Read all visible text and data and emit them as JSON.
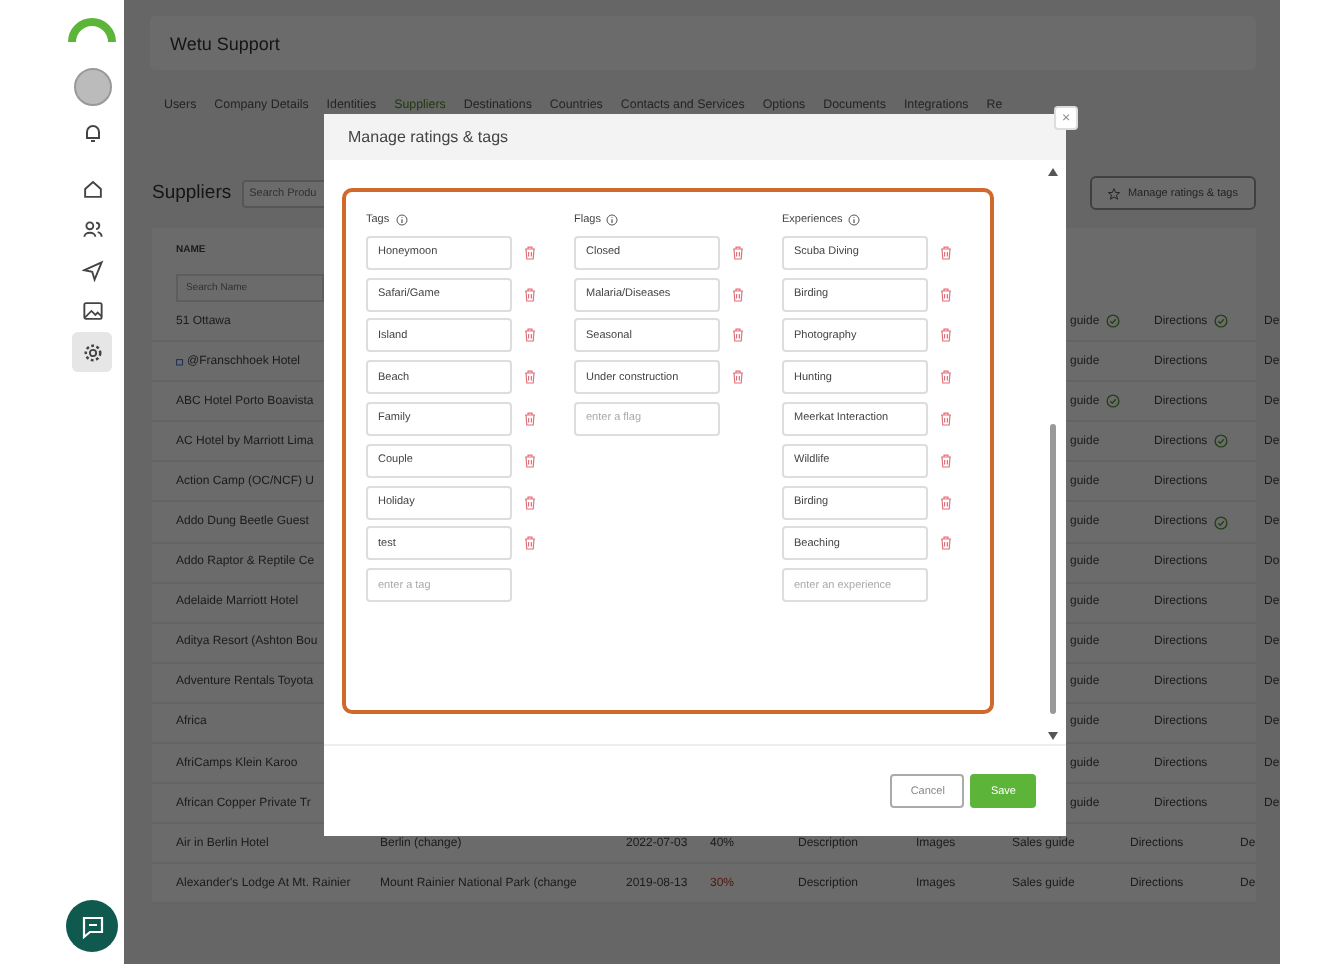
{
  "app": {
    "title": "Wetu Support"
  },
  "sidebar": {
    "items": [
      {
        "kind": "home",
        "selected": false
      },
      {
        "kind": "users",
        "selected": false
      },
      {
        "kind": "send",
        "selected": false
      },
      {
        "kind": "image",
        "selected": false
      },
      {
        "kind": "settings",
        "selected": true
      }
    ]
  },
  "tabs": [
    {
      "label": "Users",
      "selected": false
    },
    {
      "label": "Company Details",
      "selected": false
    },
    {
      "label": "Identities",
      "selected": false
    },
    {
      "label": "Suppliers",
      "selected": true
    },
    {
      "label": "Destinations",
      "selected": false
    },
    {
      "label": "Countries",
      "selected": false
    },
    {
      "label": "Contacts and Services",
      "selected": false
    },
    {
      "label": "Options",
      "selected": false
    },
    {
      "label": "Documents",
      "selected": false
    },
    {
      "label": "Integrations",
      "selected": false
    },
    {
      "label": "Re",
      "selected": false
    }
  ],
  "suppliers": {
    "heading": "Suppliers",
    "search": {
      "placeholder": "Search Produ"
    },
    "manage_button": "Manage ratings & tags",
    "table": {
      "columns": [
        "NAME"
      ],
      "name_search": {
        "placeholder": "Search Name"
      },
      "rows": [
        {
          "kind": "behind",
          "name": "51 Ottawa",
          "sales": "guide",
          "sales_check": true,
          "directions": "Directions",
          "directions_check": true,
          "last": "De"
        },
        {
          "kind": "behind",
          "name": "@Franschhoek Hotel",
          "name_icon": true,
          "sales": "guide",
          "sales_check": false,
          "directions": "Directions",
          "directions_check": false,
          "last": "De"
        },
        {
          "kind": "behind",
          "name": "ABC Hotel Porto Boavista",
          "sales": "guide",
          "sales_check": true,
          "directions": "Directions",
          "directions_check": false,
          "last": "De"
        },
        {
          "kind": "behind",
          "name": "AC Hotel by Marriott Lima",
          "sales": "guide",
          "sales_check": false,
          "directions": "Directions",
          "directions_check": true,
          "last": "De"
        },
        {
          "kind": "behind",
          "name": "Action Camp (OC/NCF) U",
          "sales": "guide",
          "sales_check": false,
          "directions": "Directions",
          "directions_check": false,
          "last": "De"
        },
        {
          "kind": "behind",
          "name": "Addo Dung Beetle Guest",
          "sales": "guide",
          "sales_check": false,
          "directions": "Directions",
          "directions_check": true,
          "last": "De"
        },
        {
          "kind": "behind",
          "name": "Addo Raptor & Reptile Ce",
          "sales": "guide",
          "sales_check": false,
          "directions": "Directions",
          "directions_check": false,
          "last": "Do"
        },
        {
          "kind": "behind",
          "name": "Adelaide Marriott Hotel",
          "sales": "guide",
          "sales_check": false,
          "directions": "Directions",
          "directions_check": false,
          "last": "De"
        },
        {
          "kind": "behind",
          "name": "Aditya Resort (Ashton Bou",
          "sales": "guide",
          "sales_check": false,
          "directions": "Directions",
          "directions_check": false,
          "last": "De"
        },
        {
          "kind": "behind",
          "name": "Adventure Rentals Toyota",
          "sales": "guide",
          "sales_check": false,
          "directions": "Directions",
          "directions_check": false,
          "last": "De"
        },
        {
          "kind": "behind",
          "name": "Africa",
          "sales": "guide",
          "sales_check": false,
          "directions": "Directions",
          "directions_check": false,
          "last": "De"
        },
        {
          "kind": "behind",
          "name": "AfriCamps Klein Karoo",
          "sales": "guide",
          "sales_check": false,
          "directions": "Directions",
          "directions_check": false,
          "last": "De"
        },
        {
          "kind": "behind",
          "name": "African Copper Private Tr",
          "sales": "guide",
          "sales_check": false,
          "directions": "Directions",
          "directions_check": false,
          "last": "De"
        },
        {
          "kind": "full",
          "name": "Air in Berlin Hotel",
          "location": "Berlin (change)",
          "date": "2022-07-03",
          "score": "40%",
          "score_warning": false,
          "description": "Description",
          "images": "Images",
          "sales": "Sales guide",
          "directions": "Directions",
          "last": "De"
        },
        {
          "kind": "full",
          "name": "Alexander's Lodge At Mt. Rainier",
          "location": "Mount Rainier National Park (change",
          "date": "2019-08-13",
          "score": "30%",
          "score_warning": true,
          "description": "Description",
          "images": "Images",
          "sales": "Sales guide",
          "directions": "Directions",
          "last": "De"
        }
      ]
    }
  },
  "modal": {
    "title": "Manage ratings & tags",
    "close": "×",
    "groups": [
      {
        "label": "Tags",
        "items": [
          "Honeymoon",
          "Safari/Game",
          "Island",
          "Beach",
          "Family",
          "Couple",
          "Holiday",
          "test"
        ],
        "placeholder": "enter a tag"
      },
      {
        "label": "Flags",
        "items": [
          "Closed",
          "Malaria/Diseases",
          "Seasonal",
          "Under construction"
        ],
        "placeholder": "enter a flag"
      },
      {
        "label": "Experiences",
        "items": [
          "Scuba Diving",
          "Birding",
          "Photography",
          "Hunting",
          "Meerkat Interaction",
          "Wildlife",
          "Birding",
          "Beaching"
        ],
        "placeholder": "enter an experience"
      }
    ],
    "buttons": [
      {
        "label": "Cancel",
        "kind": "secondary"
      },
      {
        "label": "Save",
        "kind": "primary"
      }
    ]
  }
}
